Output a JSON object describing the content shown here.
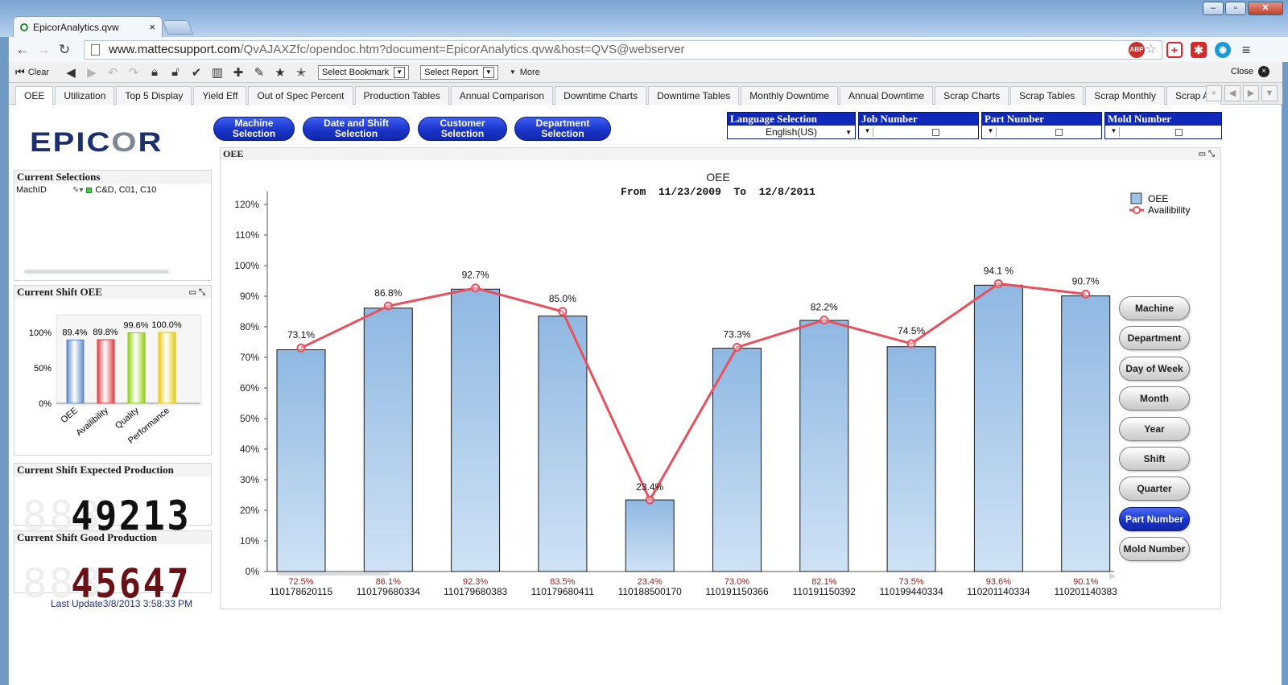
{
  "browser": {
    "tab_title": "EpicorAnalytics.qvw",
    "url_host": "www.mattecsupport.com",
    "url_path": "/QvAJAXZfc/opendoc.htm?document=EpicorAnalytics.qvw&host=QVS@webserver"
  },
  "qv_toolbar": {
    "clear_label": "Clear",
    "bookmark_select": "Select Bookmark",
    "report_select": "Select Report",
    "more_label": "More",
    "close_label": "Close"
  },
  "sheet_tabs": [
    "OEE",
    "Utilization",
    "Top 5 Display",
    "Yield Eff",
    "Out of Spec Percent",
    "Production Tables",
    "Annual Comparison",
    "Downtime Charts",
    "Downtime Tables",
    "Monthly Downtime",
    "Annual Downtime",
    "Scrap Charts",
    "Scrap Tables",
    "Scrap Monthly",
    "Scrap Ar"
  ],
  "logo_text": "EPICOR",
  "selection_buttons": [
    "Machine Selection",
    "Date and Shift Selection",
    "Customer Selection",
    "Department Selection"
  ],
  "listboxes": [
    {
      "title": "Language Selection",
      "value": "English(US)"
    },
    {
      "title": "Job Number",
      "value": ""
    },
    {
      "title": "Part Number",
      "value": ""
    },
    {
      "title": "Mold Number",
      "value": ""
    }
  ],
  "current_selections": {
    "title": "Current Selections",
    "field": "MachID",
    "value": "C&D, C01, C10"
  },
  "shift_oee": {
    "title": "Current Shift OEE",
    "ticks": [
      "100%",
      "50%",
      "0%"
    ],
    "bars": [
      {
        "label": "OEE",
        "value": 89.4,
        "display": "89.4%",
        "color": "#5b87c5"
      },
      {
        "label": "Availibility",
        "value": 89.8,
        "display": "89.8%",
        "color": "#e2383f"
      },
      {
        "label": "Quality",
        "value": 99.6,
        "display": "99.6%",
        "color": "#8fcf0e"
      },
      {
        "label": "Performance",
        "value": 100.0,
        "display": "100.0%",
        "color": "#e6c90a"
      }
    ]
  },
  "expected_production": {
    "title": "Current Shift Expected Production",
    "value": "49213",
    "ghost": "888"
  },
  "good_production": {
    "title": "Current Shift Good Production",
    "value": "45647",
    "ghost": "888"
  },
  "last_update": "Last Update3/8/2013 3:58:33 PM",
  "chart_box_title": "OEE",
  "chart_data": {
    "type": "bar",
    "title": "OEE",
    "subtitle": "From  11/23/2009  To  12/8/2011",
    "ylim": [
      0,
      120
    ],
    "y_ticks": [
      0,
      10,
      20,
      30,
      40,
      50,
      60,
      70,
      80,
      90,
      100,
      110,
      120
    ],
    "categories": [
      "110178620115",
      "110179680334",
      "110179680383",
      "110179680411",
      "110188500170",
      "110191150366",
      "110191150392",
      "110199440334",
      "110201140334",
      "110201140383"
    ],
    "series": [
      {
        "name": "OEE",
        "type": "bar",
        "color": "#9fc3e7",
        "values": [
          72.5,
          86.1,
          92.3,
          83.5,
          23.4,
          73.0,
          82.1,
          73.5,
          93.6,
          90.1
        ],
        "labels": [
          "72.5%",
          "86.1%",
          "92.3%",
          "83.5%",
          "23.4%",
          "73.0%",
          "82.1%",
          "73.5%",
          "93.6%",
          "90.1%"
        ]
      },
      {
        "name": "Availibility",
        "type": "line",
        "color": "#e8505e",
        "values": [
          73.1,
          86.8,
          92.7,
          85.0,
          23.4,
          73.3,
          82.2,
          74.5,
          94.1,
          90.7
        ],
        "labels": [
          "73.1%",
          "86.8%",
          "92.7%",
          "85.0%",
          "23.4%",
          "73.3%",
          "82.2%",
          "74.5%",
          "94.1 %",
          "90.7%"
        ]
      }
    ],
    "legend": "top-right",
    "grid": false
  },
  "side_buttons": [
    {
      "label": "Machine",
      "active": false
    },
    {
      "label": "Department",
      "active": false
    },
    {
      "label": "Day of Week",
      "active": false
    },
    {
      "label": "Month",
      "active": false
    },
    {
      "label": "Year",
      "active": false
    },
    {
      "label": "Shift",
      "active": false
    },
    {
      "label": "Quarter",
      "active": false
    },
    {
      "label": "Part Number",
      "active": true
    },
    {
      "label": "Mold Number",
      "active": false
    }
  ]
}
